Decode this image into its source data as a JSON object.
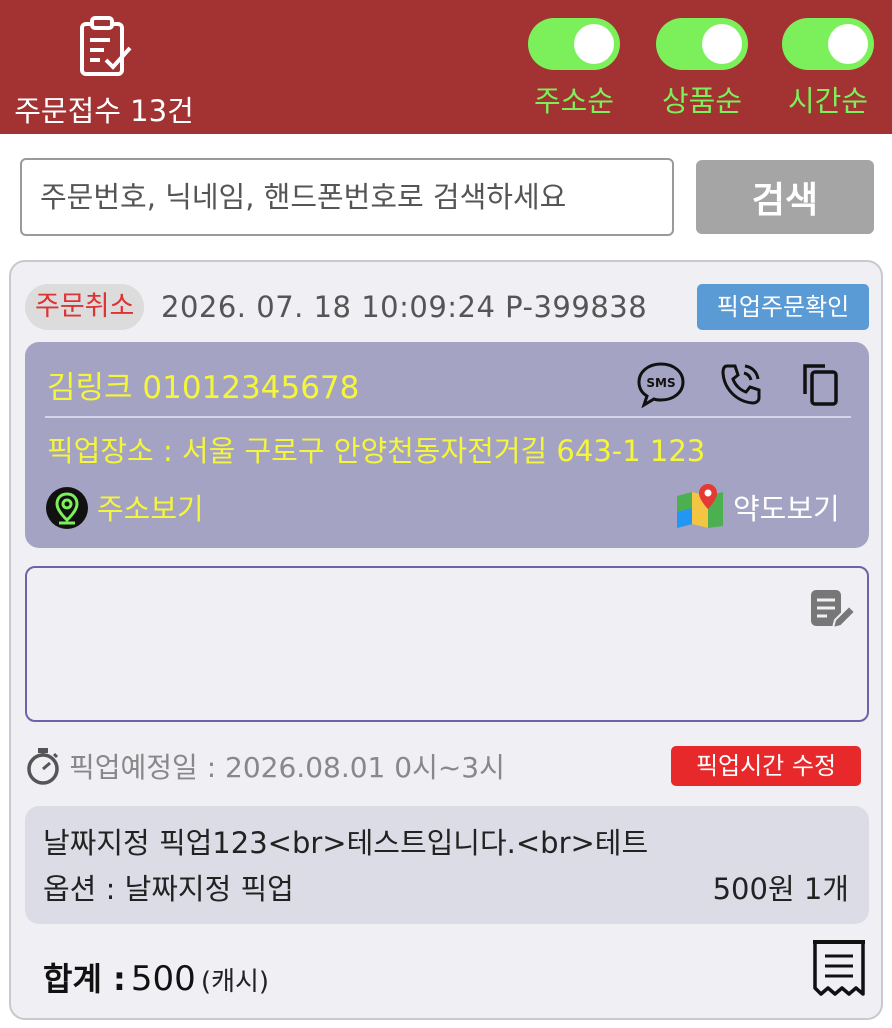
{
  "header": {
    "order_count_label": "주문접수 13건",
    "order_icon": "clipboard-check-icon",
    "accent_color": "#a33233",
    "toggles": [
      {
        "label": "주소순",
        "on": true
      },
      {
        "label": "상품순",
        "on": true
      },
      {
        "label": "시간순",
        "on": true
      }
    ],
    "toggle_color": "#7bf05a"
  },
  "search": {
    "placeholder": "주문번호, 닉네임, 핸드폰번호로 검색하세요",
    "value": "",
    "button_label": "검색"
  },
  "order": {
    "status_badge": "주문취소",
    "meta": "2026. 07. 18 10:09:24 P-399838",
    "confirm_badge": "픽업주문확인",
    "customer": {
      "name_phone": "김링크 01012345678",
      "sms_icon": "sms-icon",
      "sms_text": "SMS",
      "call_icon": "phone-call-icon",
      "copy_icon": "copy-icon",
      "pickup_location": "픽업장소 : 서울 구로구 안양천동자전거길 643-1 123",
      "address_view_label": "주소보기",
      "address_view_icon": "location-pin-icon",
      "map_view_label": "약도보기",
      "map_view_icon": "map-icon"
    },
    "memo": {
      "value": "",
      "edit_icon": "memo-edit-icon"
    },
    "pickup_date": "픽업예정일 : 2026.08.01 0시~3시",
    "pickup_time_edit_label": "픽업시간 수정",
    "product": {
      "name": "날짜지정 픽업123<br>테스트입니다.<br>테트",
      "option": "옵션 : 날짜지정 픽업",
      "price_qty": "500원 1개"
    },
    "total": {
      "label": "합계 :",
      "amount": "500",
      "unit": "(캐시)"
    },
    "receipt_icon": "receipt-icon"
  }
}
